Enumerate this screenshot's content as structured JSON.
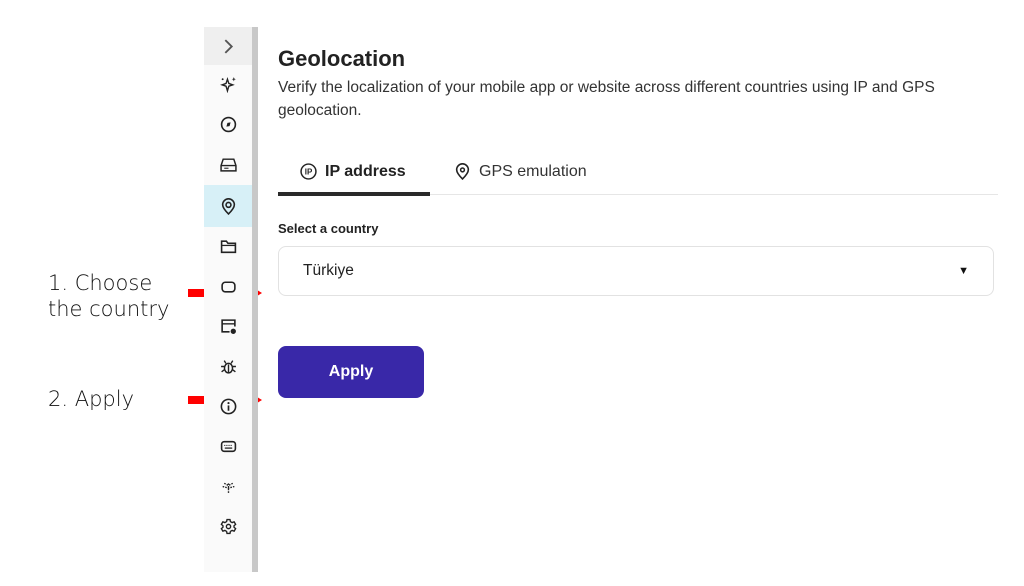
{
  "annotations": {
    "step1_line1": "1. Choose",
    "step1_line2": "the country",
    "step2": "2. Apply",
    "arrow_color": "#ff0000"
  },
  "sidebar": {
    "items": [
      {
        "icon": "chevron-right-icon",
        "state": "expand"
      },
      {
        "icon": "sparkles-icon"
      },
      {
        "icon": "compass-icon"
      },
      {
        "icon": "hard-drive-icon"
      },
      {
        "icon": "location-pin-icon",
        "state": "active"
      },
      {
        "icon": "folder-icon"
      },
      {
        "icon": "camera-icon"
      },
      {
        "icon": "window-settings-icon"
      },
      {
        "icon": "bug-icon"
      },
      {
        "icon": "info-icon"
      },
      {
        "icon": "keyboard-icon"
      },
      {
        "icon": "network-signal-icon"
      },
      {
        "icon": "gear-icon"
      }
    ],
    "active_color": "#d7f0f7"
  },
  "main": {
    "title": "Geolocation",
    "description": "Verify the localization of your mobile app or website across different countries using IP and GPS geolocation.",
    "tabs": [
      {
        "label": "IP address",
        "icon": "ip-icon",
        "active": true
      },
      {
        "label": "GPS emulation",
        "icon": "location-pin-icon",
        "active": false
      }
    ],
    "country_label": "Select a country",
    "country_value": "Türkiye",
    "apply_label": "Apply",
    "apply_color": "#3928a8"
  }
}
